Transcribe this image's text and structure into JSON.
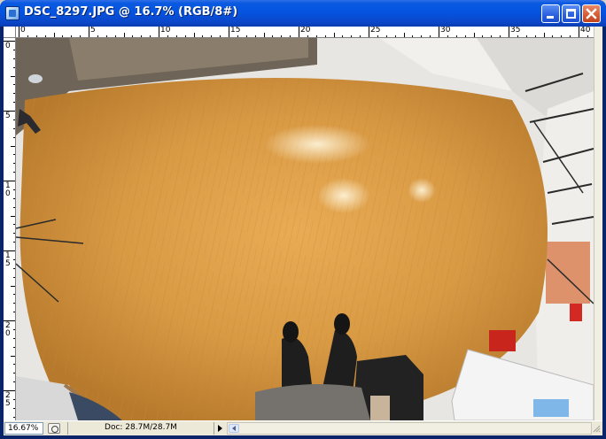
{
  "window": {
    "title": "DSC_8297.JPG @ 16.7% (RGB/8#)",
    "app_icon": "photoshop-document-icon",
    "controls": [
      "minimize-icon",
      "maximize-icon",
      "close-icon"
    ]
  },
  "rulers": {
    "horizontal_labels": [
      "0",
      "5",
      "10",
      "15",
      "20",
      "25",
      "30",
      "35",
      "40"
    ],
    "vertical_labels": [
      "0",
      "5",
      "1\n0",
      "1\n5",
      "2\n0",
      "2\n5"
    ]
  },
  "status": {
    "zoom": "16.67%",
    "doc_info": "Doc: 28.7M/28.7M"
  },
  "colors": {
    "titlebar": "#0554e0",
    "floor": "#d99a44",
    "chrome": "#d4d0c8"
  }
}
